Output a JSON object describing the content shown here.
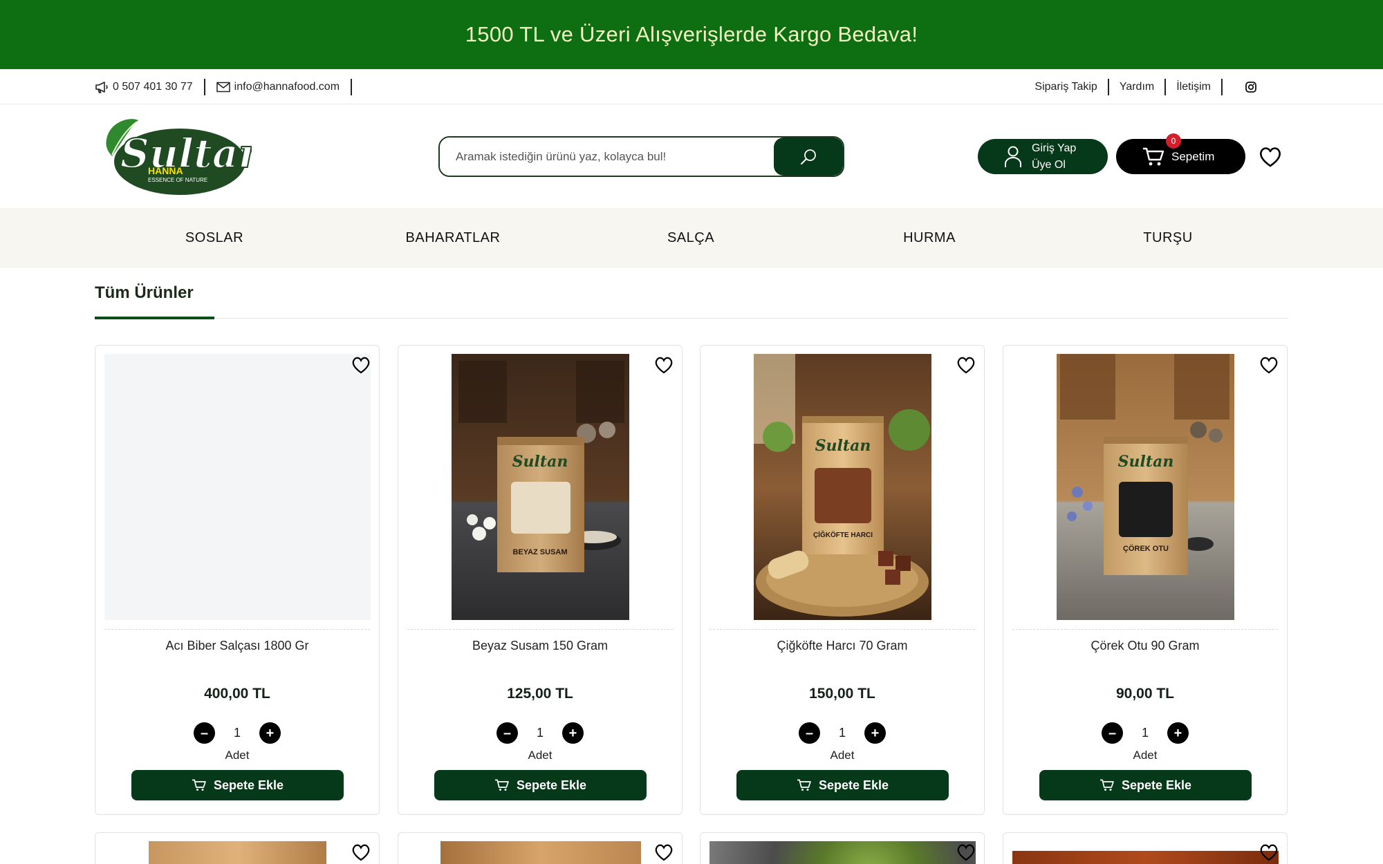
{
  "promo": {
    "text": "1500 TL ve Üzeri Alışverişlerde Kargo Bedava!"
  },
  "topbar": {
    "phone": "0 507 401 30 77",
    "email": "info@hannafood.com",
    "links": [
      "Sipariş Takip",
      "Yardım",
      "İletişim"
    ]
  },
  "logo": {
    "brand": "Sultan",
    "sub": "HANNA",
    "tagline": "ESSENCE OF NATURE"
  },
  "search": {
    "placeholder": "Aramak istediğin ürünü yaz, kolayca bul!"
  },
  "account": {
    "login": "Giriş Yap",
    "register": "Üye Ol"
  },
  "cart": {
    "label": "Sepetim",
    "count": "0"
  },
  "nav": [
    "SOSLAR",
    "BAHARATLAR",
    "SALÇA",
    "HURMA",
    "TURŞU"
  ],
  "section": {
    "title": "Tüm Ürünler"
  },
  "products": [
    {
      "name": "Acı Biber Salçası 1800 Gr",
      "price": "400,00 TL",
      "qty": "1",
      "unit": "Adet",
      "button": "Sepete Ekle"
    },
    {
      "name": "Beyaz Susam 150 Gram",
      "price": "125,00 TL",
      "qty": "1",
      "unit": "Adet",
      "button": "Sepete Ekle",
      "package_brand": "Sultan",
      "package_label": "BEYAZ SUSAM"
    },
    {
      "name": "Çiğköfte Harcı 70 Gram",
      "price": "150,00 TL",
      "qty": "1",
      "unit": "Adet",
      "button": "Sepete Ekle",
      "package_brand": "Sultan",
      "package_label": "ÇİĞKÖFTE HARCI"
    },
    {
      "name": "Çörek Otu 90 Gram",
      "price": "90,00 TL",
      "qty": "1",
      "unit": "Adet",
      "button": "Sepete Ekle",
      "package_brand": "Sultan",
      "package_label": "ÇÖREK OTU"
    }
  ],
  "colors": {
    "promo": "#0d6e12",
    "primary": "#06391a",
    "nav_bg": "#f8f6f0",
    "badge": "#d21f2c"
  }
}
